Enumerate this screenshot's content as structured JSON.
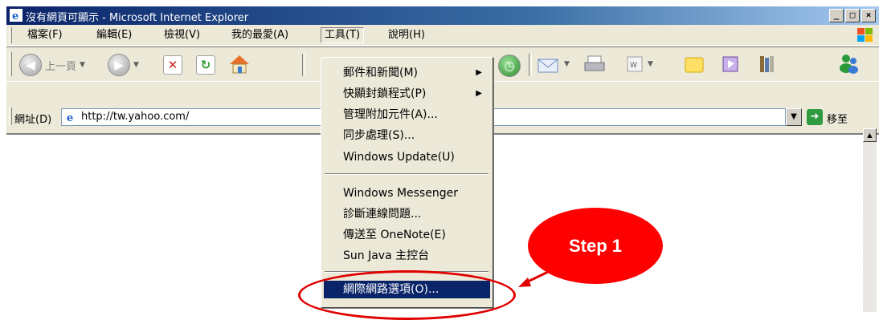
{
  "window": {
    "title": "沒有網頁可顯示 - Microsoft Internet Explorer",
    "buttons": [
      "_",
      "□",
      "×"
    ]
  },
  "menubar": {
    "items": [
      "檔案(F)",
      "編輯(E)",
      "檢視(V)",
      "我的最愛(A)",
      "工具(T)",
      "說明(H)"
    ],
    "open_item": "工具(T)"
  },
  "toolbar": {
    "back_label": "上一頁"
  },
  "address": {
    "label": "網址(D)",
    "url": "http://tw.yahoo.com/",
    "go_label": "移至"
  },
  "tools_menu": {
    "items": [
      {
        "label": "郵件和新聞(M)",
        "submenu": true
      },
      {
        "label": "快顯封鎖程式(P)",
        "submenu": true
      },
      {
        "label": "管理附加元件(A)..."
      },
      {
        "label": "同步處理(S)..."
      },
      {
        "label": "Windows Update(U)"
      },
      {
        "label": "Windows Messenger"
      },
      {
        "label": "診斷連線問題..."
      },
      {
        "label": "傳送至 OneNote(E)"
      },
      {
        "label": "Sun Java 主控台"
      },
      {
        "label": "網際網路選項(O)...",
        "highlighted": true
      }
    ]
  },
  "callout": {
    "label": "Step 1",
    "color": "#ff0000"
  },
  "icons": [
    "ie-icon",
    "xp-logo-icon",
    "back-icon",
    "forward-icon",
    "stop-icon",
    "refresh-icon",
    "home-icon",
    "history-icon",
    "mail-icon",
    "print-icon",
    "edit-icon",
    "folder-icon",
    "messenger-icon",
    "go-icon"
  ]
}
